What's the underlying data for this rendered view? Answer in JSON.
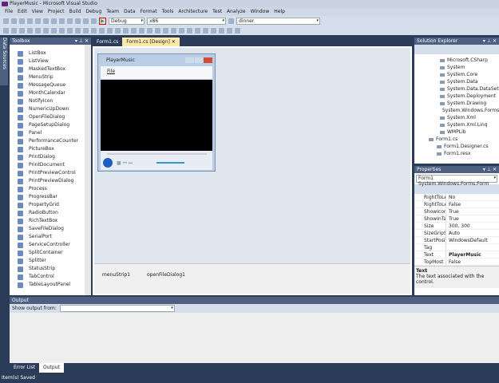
{
  "window": {
    "title": "PlayerMusic - Microsoft Visual Studio"
  },
  "menu": [
    "File",
    "Edit",
    "View",
    "Project",
    "Build",
    "Debug",
    "Team",
    "Data",
    "Format",
    "Tools",
    "Architecture",
    "Test",
    "Analyze",
    "Window",
    "Help"
  ],
  "toolbar": {
    "config": "Debug",
    "platform": "x86",
    "find": "dinner"
  },
  "datasources": "Data Sources",
  "toolbox": {
    "title": "Toolbox",
    "items": [
      "ListBox",
      "ListView",
      "MaskedTextBox",
      "MenuStrip",
      "MessageQueue",
      "MonthCalendar",
      "NotifyIcon",
      "NumericUpDown",
      "OpenFileDialog",
      "PageSetupDialog",
      "Panel",
      "PerformanceCounter",
      "PictureBox",
      "PrintDialog",
      "PrintDocument",
      "PrintPreviewControl",
      "PrintPreviewDialog",
      "Process",
      "ProgressBar",
      "PropertyGrid",
      "RadioButton",
      "RichTextBox",
      "SaveFileDialog",
      "SerialPort",
      "ServiceController",
      "SplitContainer",
      "Splitter",
      "StatusStrip",
      "TabControl",
      "TableLayoutPanel"
    ]
  },
  "tabs": [
    "Form1.cs",
    "Form1.cs [Design]"
  ],
  "form": {
    "title": "PlayerMusic",
    "menu": "File"
  },
  "tray": [
    "menuStrip1",
    "openFileDialog1"
  ],
  "solution": {
    "title": "Solution Explorer",
    "refs": [
      "Microsoft.CSharp",
      "System",
      "System.Core",
      "System.Data",
      "System.Data.DataSet",
      "System.Deployment",
      "System.Drawing",
      "System.Windows.Forms",
      "System.Xml",
      "System.Xml.Linq",
      "WMPLib"
    ],
    "file": "Form1.cs",
    "children": [
      "Form1.Designer.cs",
      "Form1.resx"
    ]
  },
  "properties": {
    "title": "Properties",
    "object": "Form1 System.Windows.Forms.Form",
    "rows": [
      [
        "RightToLeft",
        "No"
      ],
      [
        "RightToLeftLayout",
        "False"
      ],
      [
        "ShowIcon",
        "True"
      ],
      [
        "ShowInTaskbar",
        "True"
      ],
      [
        "Size",
        "300, 300"
      ],
      [
        "SizeGripStyle",
        "Auto"
      ],
      [
        "StartPosition",
        "WindowsDefault"
      ],
      [
        "Tag",
        ""
      ],
      [
        "Text",
        "PlayerMusic"
      ],
      [
        "TopMost",
        "False"
      ]
    ],
    "desc_title": "Text",
    "desc": "The text associated with the control."
  },
  "output": {
    "title": "Output",
    "label": "Show output from:"
  },
  "bottom_tabs": [
    "Error List",
    "Output"
  ],
  "status": "Item(s) Saved"
}
